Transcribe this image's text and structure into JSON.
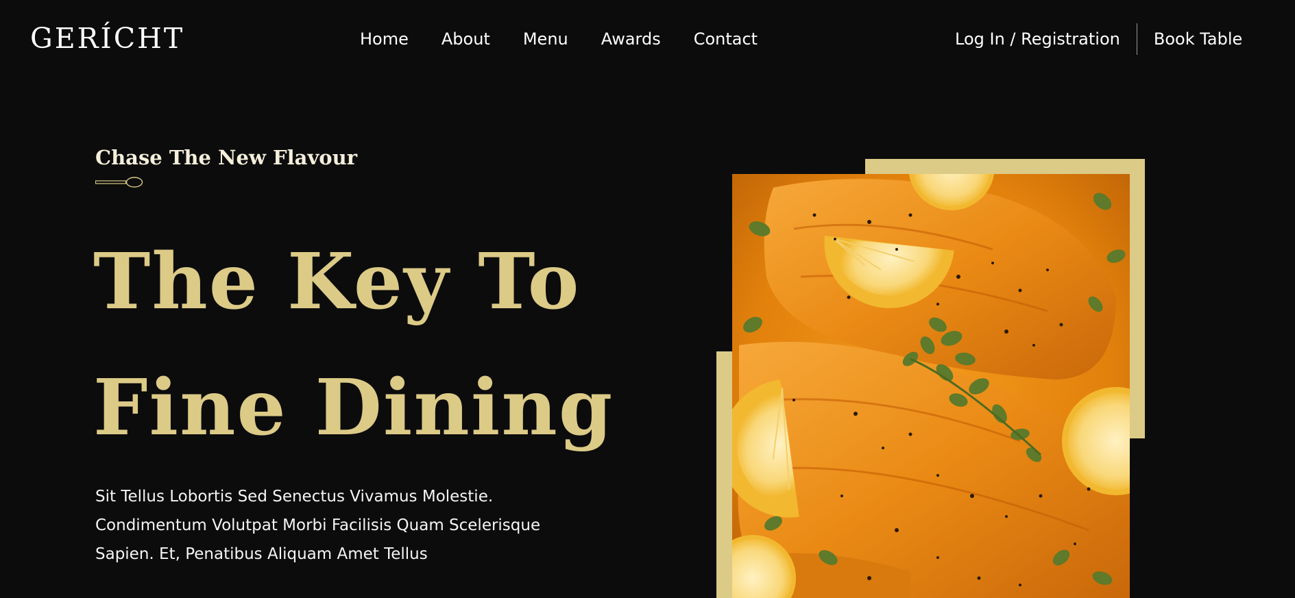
{
  "brand": {
    "logo_text": "GERÍCHT"
  },
  "nav": {
    "links": [
      {
        "label": "Home"
      },
      {
        "label": "About"
      },
      {
        "label": "Menu"
      },
      {
        "label": "Awards"
      },
      {
        "label": "Contact"
      }
    ],
    "login_label": "Log In / Registration",
    "book_label": "Book Table"
  },
  "hero": {
    "subtitle": "Chase The New Flavour",
    "headline_line1": "The Key To",
    "headline_line2": "Fine Dining",
    "description_lines": [
      "Sit Tellus Lobortis Sed Senectus Vivamus Molestie.",
      "Condimentum Volutpat Morbi Facilisis Quam Scelerisque",
      "Sapien. Et, Penatibus Aliquam Amet Tellus"
    ],
    "image_icon": "salmon-dish-photo",
    "divider_icon": "spoon-icon"
  },
  "colors": {
    "background": "#0c0c0c",
    "accent_gold": "#dcca87",
    "text_white": "#ffffff",
    "sauce_orange": "#e8870f"
  }
}
